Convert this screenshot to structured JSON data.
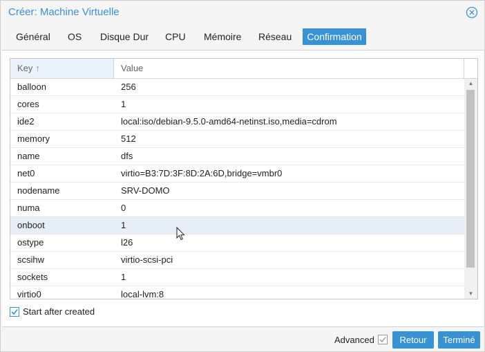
{
  "window": {
    "title": "Créer: Machine Virtuelle"
  },
  "tabs": [
    {
      "label": "Général"
    },
    {
      "label": "OS"
    },
    {
      "label": "Disque Dur"
    },
    {
      "label": "CPU"
    },
    {
      "label": "Mémoire"
    },
    {
      "label": "Réseau"
    },
    {
      "label": "Confirmation",
      "active": true
    }
  ],
  "grid": {
    "columns": {
      "key": "Key",
      "value": "Value"
    },
    "sort_icon": "arrow-up-icon",
    "rows": [
      {
        "key": "balloon",
        "value": "256"
      },
      {
        "key": "cores",
        "value": "1"
      },
      {
        "key": "ide2",
        "value": "local:iso/debian-9.5.0-amd64-netinst.iso,media=cdrom"
      },
      {
        "key": "memory",
        "value": "512"
      },
      {
        "key": "name",
        "value": "dfs"
      },
      {
        "key": "net0",
        "value": "virtio=B3:7D:3F:8D:2A:6D,bridge=vmbr0"
      },
      {
        "key": "nodename",
        "value": "SRV-DOMO"
      },
      {
        "key": "numa",
        "value": "0"
      },
      {
        "key": "onboot",
        "value": "1"
      },
      {
        "key": "ostype",
        "value": "l26"
      },
      {
        "key": "scsihw",
        "value": "virtio-scsi-pci"
      },
      {
        "key": "sockets",
        "value": "1"
      },
      {
        "key": "virtio0",
        "value": "local-lvm:8"
      }
    ]
  },
  "start_after_created": {
    "label": "Start after created",
    "checked": true
  },
  "footer": {
    "advanced_label": "Advanced",
    "advanced_checked": true,
    "back_label": "Retour",
    "finish_label": "Terminé"
  },
  "colors": {
    "accent": "#3892d4",
    "title": "#3b8fd9",
    "hover_row": "#e6eef8"
  }
}
